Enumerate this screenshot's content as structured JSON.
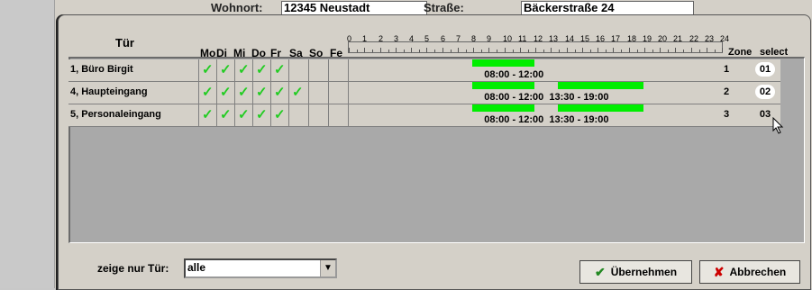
{
  "background": {
    "wohnort_label": "Wohnort:",
    "wohnort_value": "12345 Neustadt",
    "strasse_label": "Straße:",
    "strasse_value": "Bäckerstraße 24"
  },
  "grid": {
    "headers": {
      "tuer": "Tür",
      "days": [
        "Mo",
        "Di",
        "Mi",
        "Do",
        "Fr",
        "Sa",
        "So",
        "Fe"
      ],
      "zone": "Zone",
      "select": "select"
    },
    "hours": [
      "0",
      "1",
      "2",
      "3",
      "4",
      "5",
      "6",
      "7",
      "8",
      "9",
      "10",
      "11",
      "12",
      "13",
      "14",
      "15",
      "16",
      "17",
      "18",
      "19",
      "20",
      "21",
      "22",
      "23",
      "24"
    ],
    "rows": [
      {
        "name": "1, Büro Birgit",
        "days_checked": [
          true,
          true,
          true,
          true,
          true,
          false,
          false,
          false
        ],
        "intervals": [
          [
            8,
            12
          ]
        ],
        "time_text": "08:00 - 12:00",
        "zone": "1",
        "select": "01"
      },
      {
        "name": "4, Haupteingang",
        "days_checked": [
          true,
          true,
          true,
          true,
          true,
          true,
          false,
          false
        ],
        "intervals": [
          [
            8,
            12
          ],
          [
            13.5,
            19
          ]
        ],
        "time_text": "08:00 - 12:00  13:30 - 19:00",
        "zone": "2",
        "select": "02"
      },
      {
        "name": "5, Personaleingang",
        "days_checked": [
          true,
          true,
          true,
          true,
          true,
          false,
          false,
          false
        ],
        "intervals": [
          [
            8,
            12
          ],
          [
            13.5,
            19
          ]
        ],
        "time_text": "08:00 - 12:00  13:30 - 19:00",
        "zone": "3",
        "select": "03"
      }
    ]
  },
  "filter": {
    "label": "zeige nur Tür:",
    "value": "alle"
  },
  "buttons": {
    "apply": "Übernehmen",
    "cancel": "Abbrechen"
  },
  "colors": {
    "check": "#22cc22",
    "bar": "#00ee00",
    "cancel_icon": "#cc0000"
  }
}
